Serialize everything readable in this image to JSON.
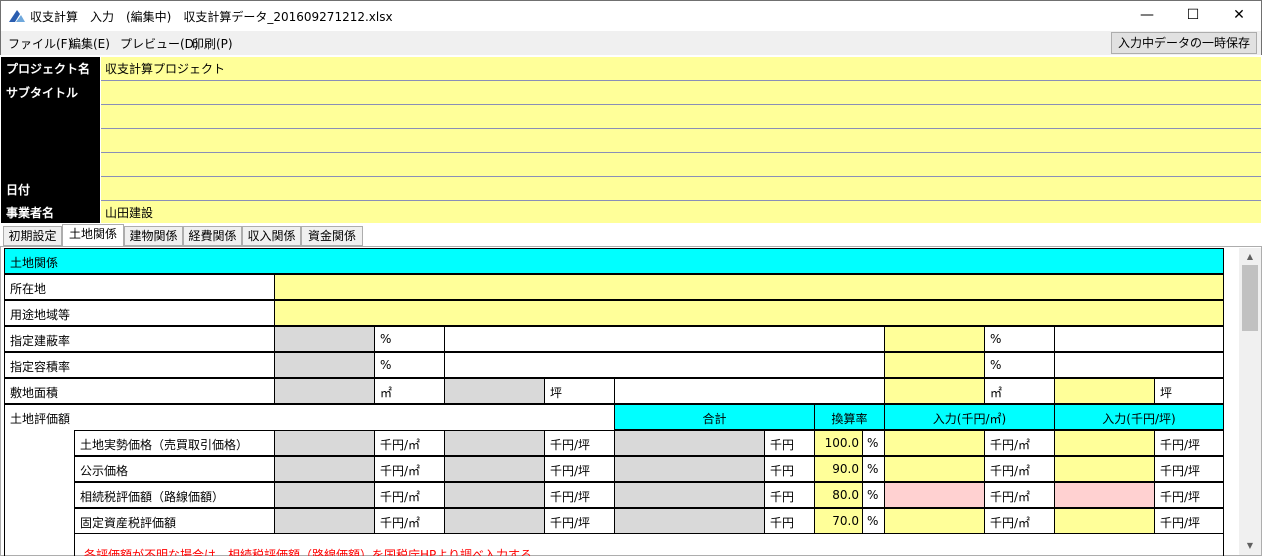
{
  "window": {
    "title": "収支計算　入力　(編集中)　収支計算データ_201609271212.xlsx",
    "controls": [
      "—",
      "☐",
      "✕"
    ]
  },
  "menu": {
    "items": [
      "ファイル(F)",
      "編集(E)",
      "プレビュー(D)",
      "印刷(P)"
    ],
    "save_temp_label": "入力中データの一時保存"
  },
  "header": {
    "project_label": "プロジェクト名",
    "project_value": "収支計算プロジェクト",
    "subtitle_label": "サブタイトル",
    "subtitle_values": [
      "",
      "",
      "",
      ""
    ],
    "date_label": "日付",
    "date_value": "",
    "company_label": "事業者名",
    "company_value": "山田建設"
  },
  "tabs": [
    "初期設定",
    "土地関係",
    "建物関係",
    "経費関係",
    "収入関係",
    "資金関係"
  ],
  "active_tab": "土地関係",
  "land": {
    "section_title": "土地関係",
    "location_label": "所在地",
    "location_value": "",
    "zoning_label": "用途地域等",
    "zoning_value": "",
    "coverage_label": "指定建蔽率",
    "far_label": "指定容積率",
    "area_label": "敷地面積",
    "valuation_label": "土地評価額",
    "units": {
      "percent": "%",
      "sqm": "㎡",
      "tsubo": "坪",
      "yen_sqm": "千円/㎡",
      "yen_tsubo": "千円/坪",
      "yen": "千円"
    },
    "headers": {
      "total": "合計",
      "rate": "換算率",
      "input_sqm": "入力(千円/㎡)",
      "input_tsubo": "入力(千円/坪)"
    },
    "rows": [
      {
        "label": "土地実勢価格（売買取引価格）",
        "rate": "100.0"
      },
      {
        "label": "公示価格",
        "rate": "90.0"
      },
      {
        "label": "相続税評価額（路線価額）",
        "rate": "80.0"
      },
      {
        "label": "固定資産税評価額",
        "rate": "70.0"
      }
    ],
    "note": "各評価額が不明な場合は、相続税評価額（路線価額）を国税庁HPより調べ入力する。"
  },
  "colors": {
    "input_yellow": "#ffff99",
    "readonly_gray": "#d9d9d9",
    "header_cyan": "#00ffff",
    "warning_pink": "#ffd1d1",
    "note_red": "#ff0000"
  }
}
